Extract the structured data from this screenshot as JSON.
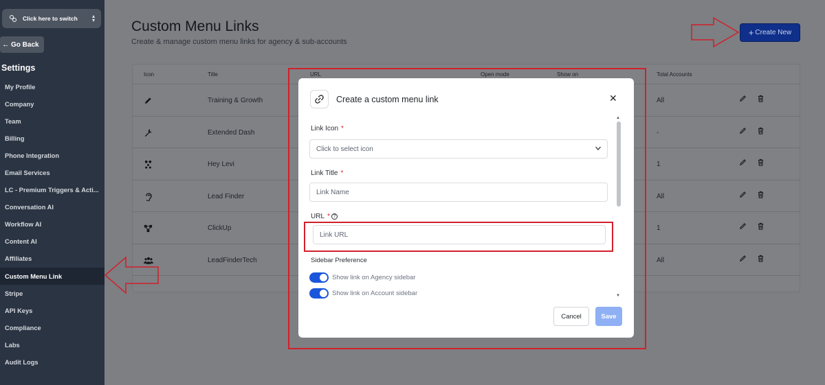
{
  "sidebar": {
    "switcher_label": "Click here to switch",
    "go_back": "Go Back",
    "settings_title": "Settings",
    "items": [
      {
        "label": "My Profile",
        "active": false
      },
      {
        "label": "Company",
        "active": false
      },
      {
        "label": "Team",
        "active": false
      },
      {
        "label": "Billing",
        "active": false
      },
      {
        "label": "Phone Integration",
        "active": false
      },
      {
        "label": "Email Services",
        "active": false
      },
      {
        "label": "LC - Premium Triggers & Acti...",
        "active": false
      },
      {
        "label": "Conversation AI",
        "active": false
      },
      {
        "label": "Workflow AI",
        "active": false
      },
      {
        "label": "Content AI",
        "active": false
      },
      {
        "label": "Affiliates",
        "active": false
      },
      {
        "label": "Custom Menu Link",
        "active": true
      },
      {
        "label": "Stripe",
        "active": false
      },
      {
        "label": "API Keys",
        "active": false
      },
      {
        "label": "Compliance",
        "active": false
      },
      {
        "label": "Labs",
        "active": false
      },
      {
        "label": "Audit Logs",
        "active": false
      }
    ]
  },
  "header": {
    "title": "Custom Menu Links",
    "subtitle": "Create & manage custom menu links for agency & sub-accounts",
    "create_button": "Create New"
  },
  "table": {
    "columns": {
      "icon": "Icon",
      "title": "Title",
      "url": "URL",
      "open_mode": "Open mode",
      "show_on": "Show on",
      "total_accounts": "Total Accounts"
    },
    "rows": [
      {
        "icon": "pen-icon",
        "title": "Training & Growth",
        "total": "All"
      },
      {
        "icon": "wrench-icon",
        "title": "Extended Dash",
        "total": "-"
      },
      {
        "icon": "molecule-icon",
        "title": "Hey Levi",
        "total": "1"
      },
      {
        "icon": "ear-icon",
        "title": "Lead Finder",
        "total": "All"
      },
      {
        "icon": "network-icon",
        "title": "ClickUp",
        "total": "1"
      },
      {
        "icon": "users-icon",
        "title": "LeadFinderTech",
        "total": "All"
      }
    ]
  },
  "modal": {
    "title": "Create a custom menu link",
    "link_icon_label": "Link Icon",
    "link_icon_placeholder": "Click to select icon",
    "link_title_label": "Link Title",
    "link_title_placeholder": "Link Name",
    "url_label": "URL",
    "url_placeholder": "Link URL",
    "required_mark": "*",
    "help_mark": "?",
    "sidebar_pref_label": "Sidebar Preference",
    "toggle_agency": "Show link on Agency sidebar",
    "toggle_account": "Show link on Account sidebar",
    "cancel": "Cancel",
    "save": "Save"
  },
  "colors": {
    "sidebar_bg": "#2b3442",
    "primary": "#1a56db",
    "annotation_red": "#d21f2a"
  }
}
